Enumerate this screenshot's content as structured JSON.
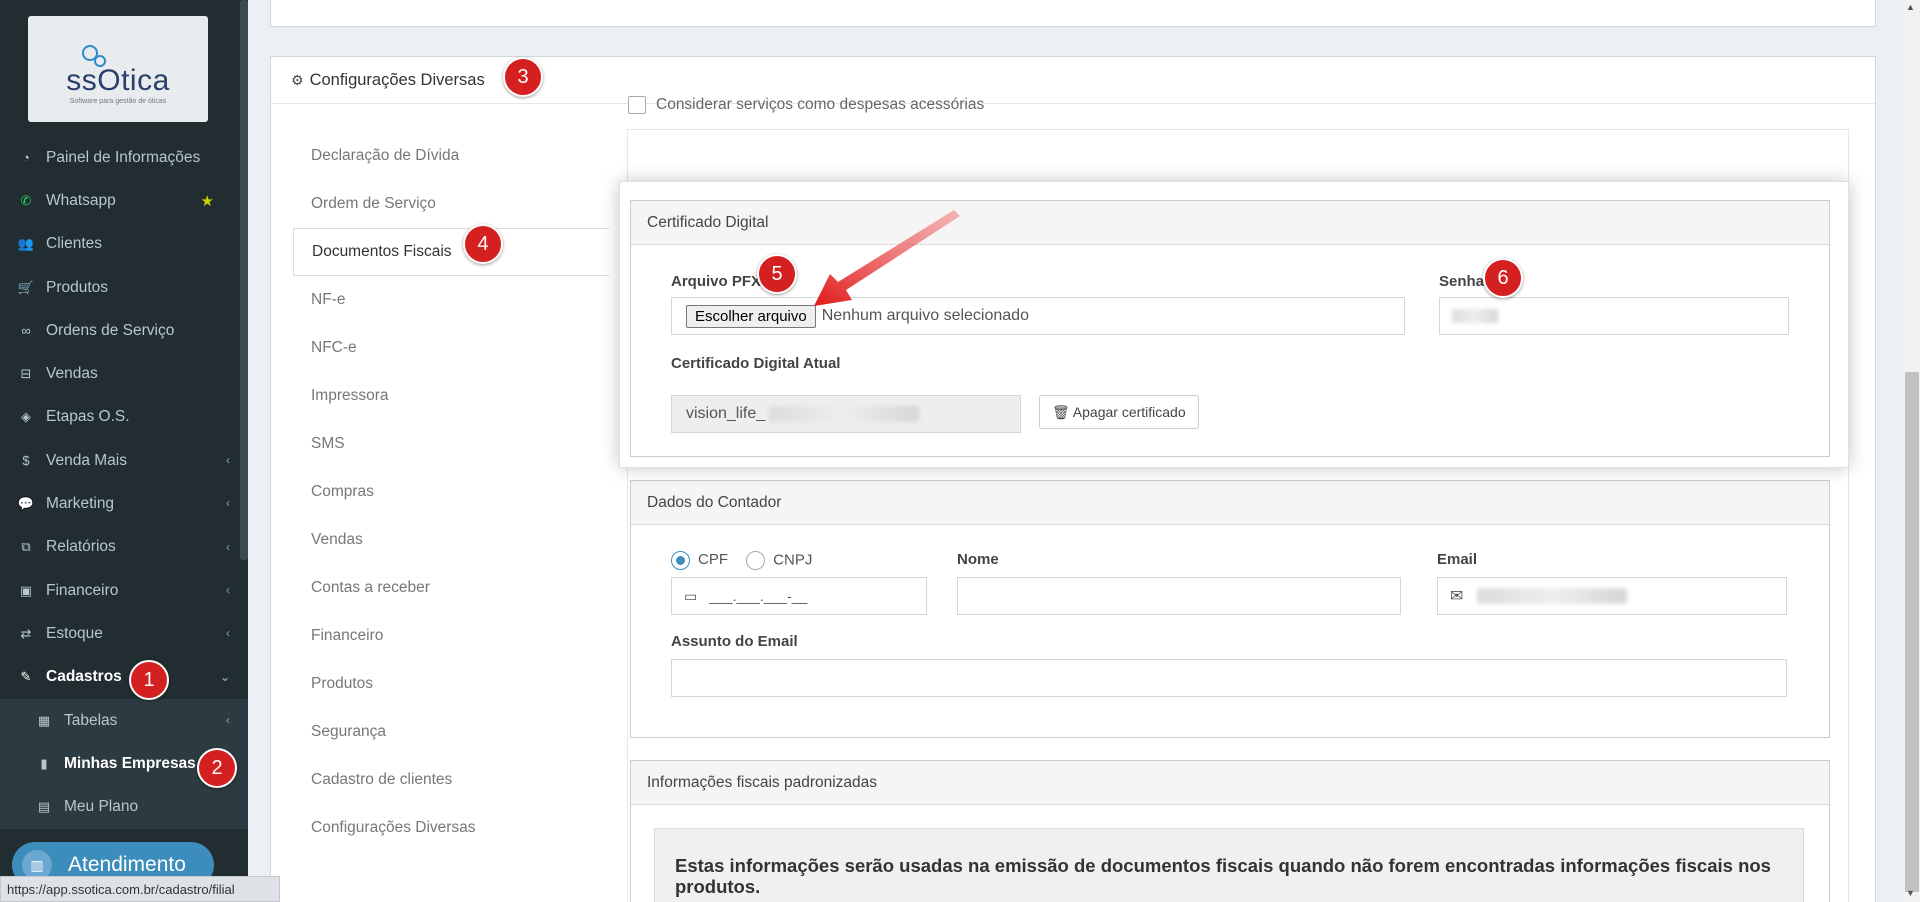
{
  "logo": {
    "text": "ssOtica",
    "subtitle": "Software para gestão de óticas"
  },
  "sidebar": {
    "items": [
      {
        "label": "Painel de Informações",
        "icon": "dashboard-icon"
      },
      {
        "label": "Whatsapp",
        "icon": "whatsapp-icon"
      },
      {
        "label": "Clientes",
        "icon": "users-icon"
      },
      {
        "label": "Produtos",
        "icon": "cart-icon"
      },
      {
        "label": "Ordens de Serviço",
        "icon": "glasses-icon"
      },
      {
        "label": "Vendas",
        "icon": "basket-icon"
      },
      {
        "label": "Etapas O.S.",
        "icon": "tag-icon"
      },
      {
        "label": "Venda Mais",
        "icon": "dollar-icon"
      },
      {
        "label": "Marketing",
        "icon": "comments-icon"
      },
      {
        "label": "Relatórios",
        "icon": "copy-icon"
      },
      {
        "label": "Financeiro",
        "icon": "money-icon"
      },
      {
        "label": "Estoque",
        "icon": "exchange-icon"
      },
      {
        "label": "Cadastros",
        "icon": "edit-icon"
      }
    ],
    "submenu": [
      {
        "label": "Tabelas",
        "icon": "table-icon"
      },
      {
        "label": "Minhas Empresas",
        "icon": "building-icon"
      },
      {
        "label": "Meu Plano",
        "icon": "file-icon"
      }
    ],
    "atendimento": "Atendimento"
  },
  "status_url": "https://app.ssotica.com.br/cadastro/filial",
  "badges": {
    "b1": "1",
    "b2": "2",
    "b3": "3",
    "b4": "4",
    "b5": "5",
    "b6": "6"
  },
  "panel": {
    "title": "Configurações Diversas"
  },
  "tabs": [
    "Declaração de Dívida",
    "Ordem de Serviço",
    "Documentos Fiscais",
    "NF-e",
    "NFC-e",
    "Impressora",
    "SMS",
    "Compras",
    "Vendas",
    "Contas a receber",
    "Financeiro",
    "Produtos",
    "Segurança",
    "Cadastro de clientes",
    "Configurações Diversas"
  ],
  "content": {
    "checkbox_label": "Considerar serviços como despesas acessórias",
    "cert": {
      "title": "Certificado Digital",
      "arquivo_label": "Arquivo PFX",
      "choose_button": "Escolher arquivo",
      "no_file": "Nenhum arquivo selecionado",
      "senha_label": "Senha",
      "atual_label": "Certificado Digital Atual",
      "atual_value": "vision_life_",
      "apagar_button": "Apagar certificado"
    },
    "contador": {
      "title": "Dados do Contador",
      "cpf": "CPF",
      "cnpj": "CNPJ",
      "cpf_mask": "___.___.___-__",
      "nome_label": "Nome",
      "email_label": "Email",
      "assunto_label": "Assunto do Email"
    },
    "fiscais": {
      "title": "Informações fiscais padronizadas",
      "text": "Estas informações serão usadas na emissão de documentos fiscais quando não forem encontradas informações fiscais nos produtos."
    }
  },
  "colors": {
    "sidebar": "#222d32",
    "badge": "#d42020",
    "accent": "#3c8dbc"
  }
}
